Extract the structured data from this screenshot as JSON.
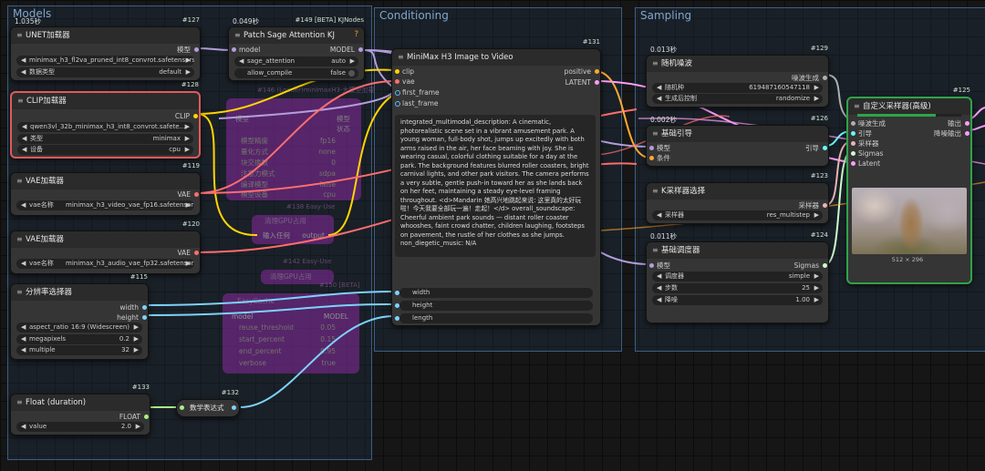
{
  "groups": {
    "models": {
      "title": "Models",
      "color": "#3f6fa0"
    },
    "conditioning": {
      "title": "Conditioning",
      "color": "#3f6fa0"
    },
    "sampling": {
      "title": "Sampling",
      "color": "#3f6fa0"
    }
  },
  "models_group_timer": "1.035秒",
  "unet": {
    "id": "#127",
    "title": "UNET加载器",
    "output": "模型",
    "model_name": "minimax_h3_fl2va_pruned_int8_convrot.safetensors",
    "weight_dtype_label": "数据类型",
    "weight_dtype": "default"
  },
  "clip": {
    "id": "#128",
    "title": "CLIP加载器",
    "output": "CLIP",
    "clip_name": "qwen3vl_32b_minimax_h3_int8_convrot.safete...",
    "type_label": "类型",
    "type_value": "minimax",
    "device_label": "设备",
    "device_value": "cpu"
  },
  "vae1": {
    "id": "#119",
    "title": "VAE加载器",
    "output": "VAE",
    "label": "vae名称",
    "value": "minimax_h3_video_vae_fp16.safetensors"
  },
  "vae2": {
    "id": "#120",
    "title": "VAE加载器",
    "output": "VAE",
    "label": "vae名称",
    "value": "minimax_h3_audio_vae_fp32.safetensors"
  },
  "resolution": {
    "id": "#115",
    "title": "分辨率选择器",
    "out_width": "width",
    "out_height": "height",
    "aspect_label": "aspect_ratio",
    "aspect_value": "16:9 (Widescreen)",
    "mp_label": "megapixels",
    "mp_value": "0.2",
    "mult_label": "multiple",
    "mult_value": "32"
  },
  "float_node": {
    "id": "#133",
    "title": "Float (duration)",
    "output": "FLOAT",
    "label": "value",
    "value": "2.0"
  },
  "math_node": {
    "id": "#132",
    "title": "数学表达式"
  },
  "patch_sage": {
    "id": "#149 [BETA] KJNodes",
    "timer": "0.049秒",
    "title": "Patch Sage Attention KJ",
    "help": "?",
    "in_model": "model",
    "out_model": "MODEL",
    "sage_label": "sage_attention",
    "sage_value": "auto",
    "compile_label": "allow_compile",
    "compile_value": "false"
  },
  "bypassed": {
    "minimax_loader": {
      "id": "#146 (Loader)minimaxH3-大模型加载",
      "in": "模型",
      "out1": "模型",
      "out2": "状态",
      "rows": [
        "模型精度",
        "量化方式",
        "块交换数",
        "注意力模式",
        "编译模型",
        "模型设备"
      ],
      "vals": [
        "fp16",
        "none",
        "0",
        "sdpa",
        "false",
        "cpu"
      ]
    },
    "clean_gpu1": {
      "id": "#138 Easy-Use",
      "title": "清理GPU占用",
      "in": "输入任何",
      "out": "output"
    },
    "clean_gpu2": {
      "id": "#142 Easy-Use",
      "title": "清理GPU占用"
    },
    "easy_cache": {
      "id": "#150 [BETA]",
      "title": "EasyCache",
      "in": "model",
      "out": "MODEL",
      "rows": [
        "reuse_threshold",
        "start_percent",
        "end_percent",
        "verbose"
      ],
      "vals": [
        "0.05",
        "0.15",
        "0.95",
        "true"
      ]
    }
  },
  "minimax_i2v": {
    "id": "#131",
    "title": "MiniMax H3 Image to Video",
    "inputs": [
      "clip",
      "vae",
      "first_frame",
      "last_frame"
    ],
    "outputs": [
      "positive",
      "LATENT"
    ],
    "prompt": "integrated_multimodal_description: A cinematic, photorealistic scene set in a vibrant amusement park. A young woman, full-body shot, jumps up excitedly with both arms raised in the air, her face beaming with joy. She is wearing casual, colorful clothing suitable for a day at the park. The background features blurred roller coasters, bright carnival lights, and other park visitors. The camera performs a very subtle, gentle push-in toward her as she lands back on her feet, maintaining a steady eye-level framing throughout. <d>Mandarin 她高兴地跳起来说: 这里真的太好玩啦！今天我要全部玩一遍！走起！</d> overall_soundscape: Cheerful ambient park sounds — distant roller coaster whooshes, faint crowd chatter, children laughing, footsteps on pavement, the rustle of her clothes as she jumps. non_diegetic_music: N/A",
    "extra": [
      "width",
      "height",
      "length"
    ]
  },
  "noise": {
    "id": "#129",
    "timer": "0.013秒",
    "title": "随机噪波",
    "output": "噪波生成",
    "seed_label": "随机种",
    "seed_value": "619487160547118",
    "ctrl_label": "生成后控制",
    "ctrl_value": "randomize"
  },
  "guider": {
    "id": "#126",
    "timer": "0.002秒",
    "title": "基础引导",
    "in1": "模型",
    "in2": "条件",
    "output": "引导"
  },
  "ksampler_select": {
    "id": "#123",
    "title": "K采样器选择",
    "output": "采样器",
    "label": "采样器",
    "value": "res_multistep"
  },
  "scheduler": {
    "id": "#124",
    "timer": "0.011秒",
    "title": "基础调度器",
    "in": "模型",
    "output": "Sigmas",
    "sched_label": "调度器",
    "sched_value": "simple",
    "steps_label": "步数",
    "steps_value": "25",
    "denoise_label": "降噪",
    "denoise_value": "1.00"
  },
  "custom_sampler": {
    "id": "#125",
    "title": "自定义采样器(高级)",
    "inputs": [
      "噪波生成",
      "引导",
      "采样器",
      "Sigmas",
      "Latent"
    ],
    "out1": "输出",
    "out2": "降噪输出",
    "preview_size": "512 × 296",
    "progress": 0.75
  },
  "colors": {
    "model": "#b39ddb",
    "clip": "#ffd500",
    "vae": "#ff6e6e",
    "conditioning": "#ffa931",
    "latent": "#ff9cf9",
    "int": "#7dd3fc",
    "float": "#aaee88",
    "noise": "#b0b0b0",
    "sampler": "#ecb4b4",
    "sigmas": "#cdffcd",
    "guider": "#66ffff"
  }
}
